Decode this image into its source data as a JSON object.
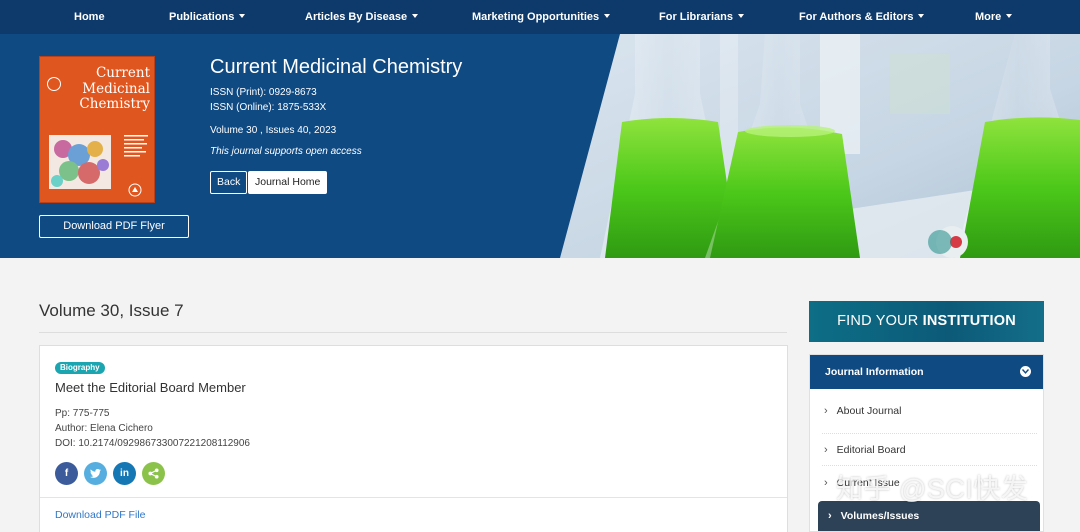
{
  "nav": {
    "items": [
      {
        "label": "Home",
        "dropdown": false
      },
      {
        "label": "Publications",
        "dropdown": true
      },
      {
        "label": "Articles By Disease",
        "dropdown": true
      },
      {
        "label": "Marketing Opportunities",
        "dropdown": true
      },
      {
        "label": "For Librarians",
        "dropdown": true
      },
      {
        "label": "For Authors & Editors",
        "dropdown": true
      },
      {
        "label": "More",
        "dropdown": true
      }
    ]
  },
  "journal": {
    "cover_title": "Current Medicinal Chemistry",
    "title": "Current Medicinal Chemistry",
    "issn_print": "ISSN (Print): 0929-8673",
    "issn_online": "ISSN (Online): 1875-533X",
    "volume_info": "Volume 30 , Issues 40, 2023",
    "open_access": "This journal supports open access",
    "back_label": "Back",
    "home_label": "Journal Home",
    "flyer_label": "Download PDF Flyer"
  },
  "issue": {
    "heading": "Volume 30, Issue 7"
  },
  "article": {
    "badge": "Biography",
    "title": "Meet the Editorial Board Member",
    "pages": "Pp: 775-775",
    "author": "Author: Elena Cichero",
    "doi": "DOI: 10.2174/0929867330072212081129​06",
    "share": {
      "facebook": "f",
      "twitter": "t",
      "linkedin": "in",
      "share": "<"
    },
    "pdf_label": "Download PDF File"
  },
  "sidebar": {
    "find_prefix": "FIND YOUR ",
    "find_bold": "INSTITUTION",
    "panel_title": "Journal Information",
    "items": [
      {
        "label": "About Journal"
      },
      {
        "label": "Editorial Board"
      },
      {
        "label": "Current Issue"
      },
      {
        "label": "Volumes/Issues"
      }
    ]
  },
  "watermark": "知乎 @SCI快发",
  "colors": {
    "nav": "#0e3a6b",
    "hero": "#0f4a83",
    "badge": "#1ba5b0",
    "link": "#2f77c7",
    "cover": "#e0561f",
    "active_item": "#2d4257"
  }
}
